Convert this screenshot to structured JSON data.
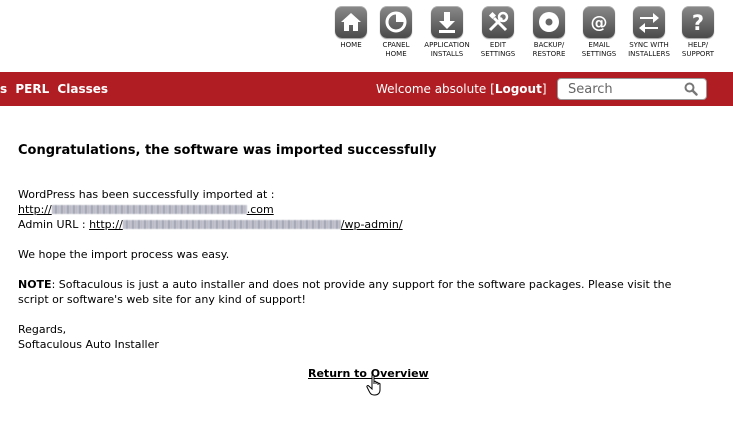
{
  "toolbar": {
    "items": [
      {
        "label_line1": "HOME",
        "label_line2": "",
        "icon": "home-icon"
      },
      {
        "label_line1": "CPANEL",
        "label_line2": "HOME",
        "icon": "cpanel-icon"
      },
      {
        "label_line1": "APPLICATION",
        "label_line2": "INSTALLS",
        "icon": "download-icon"
      },
      {
        "label_line1": "EDIT",
        "label_line2": "SETTINGS",
        "icon": "tools-icon"
      },
      {
        "label_line1": "BACKUP/",
        "label_line2": "RESTORE",
        "icon": "disc-icon"
      },
      {
        "label_line1": "EMAIL",
        "label_line2": "SETTINGS",
        "icon": "at-sign-icon"
      },
      {
        "label_line1": "SYNC WITH",
        "label_line2": "INSTALLERS",
        "icon": "sync-arrows-icon"
      },
      {
        "label_line1": "HELP/",
        "label_line2": "SUPPORT",
        "icon": "question-icon"
      }
    ]
  },
  "navbar": {
    "links": [
      "s",
      "PERL",
      "Classes"
    ],
    "welcome_text": "Welcome absolute ",
    "logout_bracket_open": "[",
    "logout_label": "Logout",
    "logout_bracket_close": "]",
    "search_placeholder": "Search",
    "background_color": "#b01e23"
  },
  "content": {
    "headline": "Congratulations, the software was imported successfully",
    "imported_at_text": "WordPress has been successfully imported at :",
    "site_url_prefix": "http://",
    "site_url_suffix": ".com",
    "admin_url_label": "Admin URL : ",
    "admin_url_prefix": "http://",
    "admin_url_suffix": "/wp-admin/",
    "hope_text": "We hope the import process was easy.",
    "note_label": "NOTE",
    "note_text_line1": ": Softaculous is just a auto installer and does not provide any support for the software packages. Please visit the",
    "note_text_line2": "script or software's web site for any kind of support!",
    "regards": "Regards,",
    "signature": "Softaculous Auto Installer",
    "return_link": "Return to Overview"
  }
}
